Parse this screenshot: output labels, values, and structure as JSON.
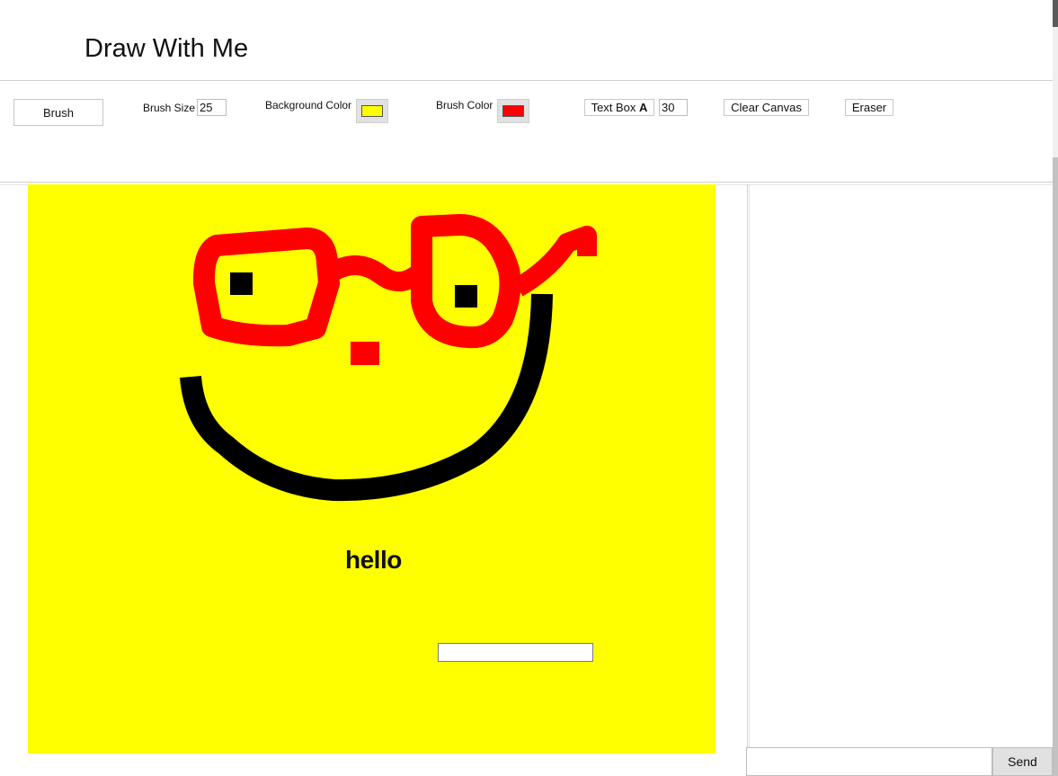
{
  "app": {
    "title": "Draw With Me"
  },
  "toolbar": {
    "brush_label": "Brush",
    "brush_size_label": "Brush Size",
    "brush_size_value": "25",
    "background_color_label": "Background Color",
    "background_color": "#ffff00",
    "brush_color_label": "Brush Color",
    "brush_color": "#ff0000",
    "text_box_label": "Text Box",
    "text_box_icon": "A",
    "text_size_value": "30",
    "clear_canvas_label": "Clear Canvas",
    "eraser_label": "Eraser"
  },
  "canvas": {
    "background": "#ffff00",
    "text": "hello",
    "text_input_value": ""
  },
  "chat": {
    "input_value": "",
    "send_label": "Send"
  }
}
